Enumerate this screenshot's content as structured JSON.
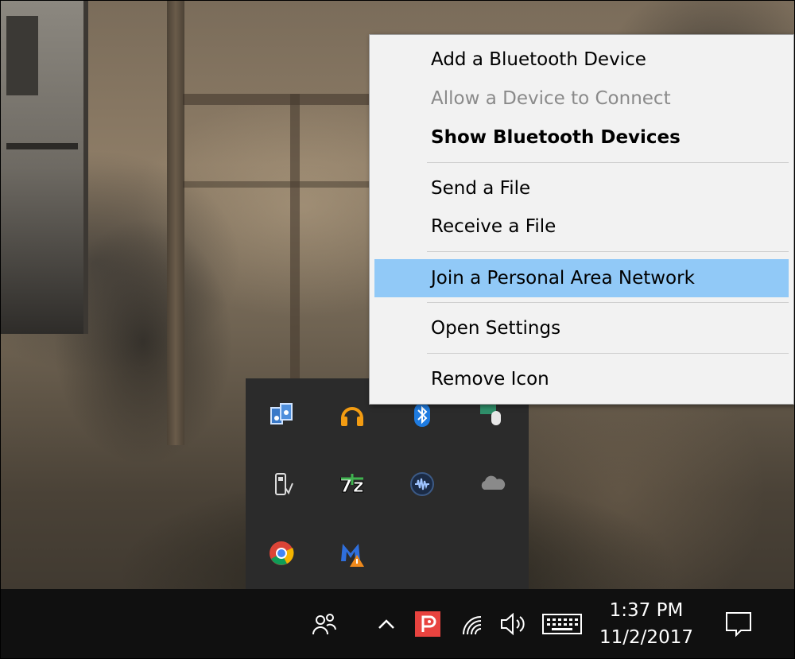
{
  "context_menu": {
    "items": [
      {
        "label": "Add a Bluetooth Device",
        "state": "normal"
      },
      {
        "label": "Allow a Device to Connect",
        "state": "disabled"
      },
      {
        "label": "Show Bluetooth Devices",
        "state": "default-bold"
      },
      {
        "label": "Send a File",
        "state": "normal"
      },
      {
        "label": "Receive a File",
        "state": "normal"
      },
      {
        "label": "Join a Personal Area Network",
        "state": "highlighted"
      },
      {
        "label": "Open Settings",
        "state": "normal"
      },
      {
        "label": "Remove Icon",
        "state": "normal"
      }
    ],
    "highlight_color": "#91c9f7"
  },
  "tray_overflow": {
    "icons": [
      "audio-manager-icon",
      "headphones-icon",
      "bluetooth-icon",
      "mouse-keyboard-icon",
      "usb-safely-remove-icon",
      "7zip-icon",
      "waveform-audio-icon",
      "onedrive-cloud-icon",
      "chrome-icon",
      "malwarebytes-warning-icon"
    ]
  },
  "taskbar": {
    "icons": [
      "people-icon",
      "show-hidden-icons-chevron-icon",
      "pushbullet-icon",
      "wifi-icon",
      "volume-icon",
      "touch-keyboard-icon",
      "action-center-icon"
    ],
    "clock": {
      "time": "1:37 PM",
      "date": "11/2/2017"
    }
  }
}
